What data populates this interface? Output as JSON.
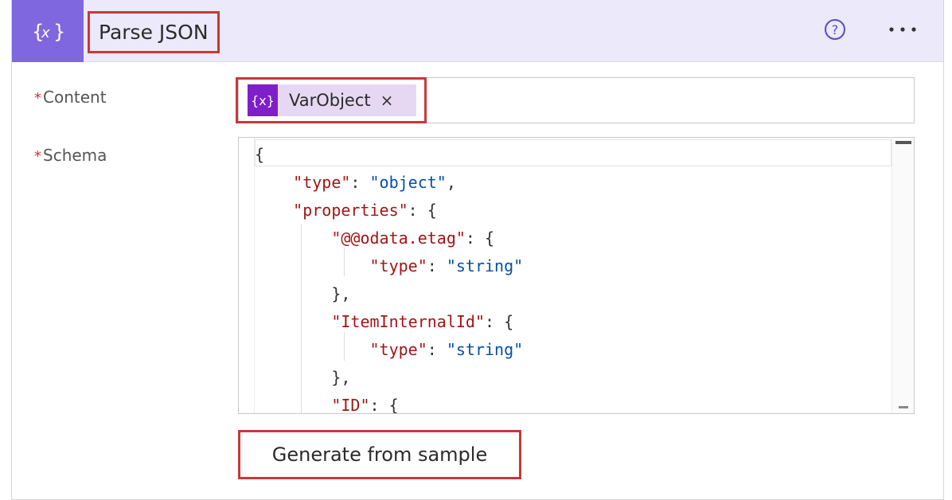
{
  "action": {
    "title": "Parse JSON",
    "icon": "variable-braces-icon",
    "accent_color": "#7f68df",
    "header_bg": "#ebe9fa"
  },
  "header_buttons": {
    "help_icon": "question-circle-icon",
    "more_label": "···"
  },
  "fields": {
    "content": {
      "required_marker": "*",
      "label": "Content",
      "token": {
        "icon_text": "{x}",
        "label": "VarObject",
        "remove": "×",
        "color": "#7f1fc9"
      }
    },
    "schema": {
      "required_marker": "*",
      "label": "Schema",
      "code_lines": [
        "{",
        "    \"type\": \"object\",",
        "    \"properties\": {",
        "        \"@@odata.etag\": {",
        "            \"type\": \"string\"",
        "        },",
        "        \"ItemInternalId\": {",
        "            \"type\": \"string\"",
        "        },",
        "        \"ID\": {"
      ]
    }
  },
  "buttons": {
    "generate_label": "Generate from sample"
  },
  "highlight_color": "#c8383a"
}
